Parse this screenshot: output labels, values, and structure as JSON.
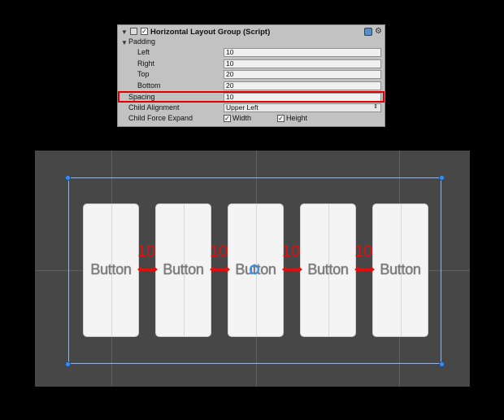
{
  "inspector": {
    "title": "Horizontal Layout Group (Script)",
    "padding_label": "Padding",
    "rows": [
      {
        "label": "Left",
        "value": "10"
      },
      {
        "label": "Right",
        "value": "10"
      },
      {
        "label": "Top",
        "value": "20"
      },
      {
        "label": "Bottom",
        "value": "20"
      }
    ],
    "spacing": {
      "label": "Spacing",
      "value": "10"
    },
    "child_alignment": {
      "label": "Child Alignment",
      "value": "Upper Left"
    },
    "child_force_expand": {
      "label": "Child Force Expand",
      "width_label": "Width",
      "height_label": "Height",
      "width_checked": true,
      "height_checked": true
    }
  },
  "scene": {
    "buttons": [
      "Button",
      "Button",
      "Button",
      "Button",
      "Button"
    ],
    "gap_labels": [
      "10",
      "10",
      "10",
      "10"
    ],
    "highlight_color": "#e01010"
  }
}
